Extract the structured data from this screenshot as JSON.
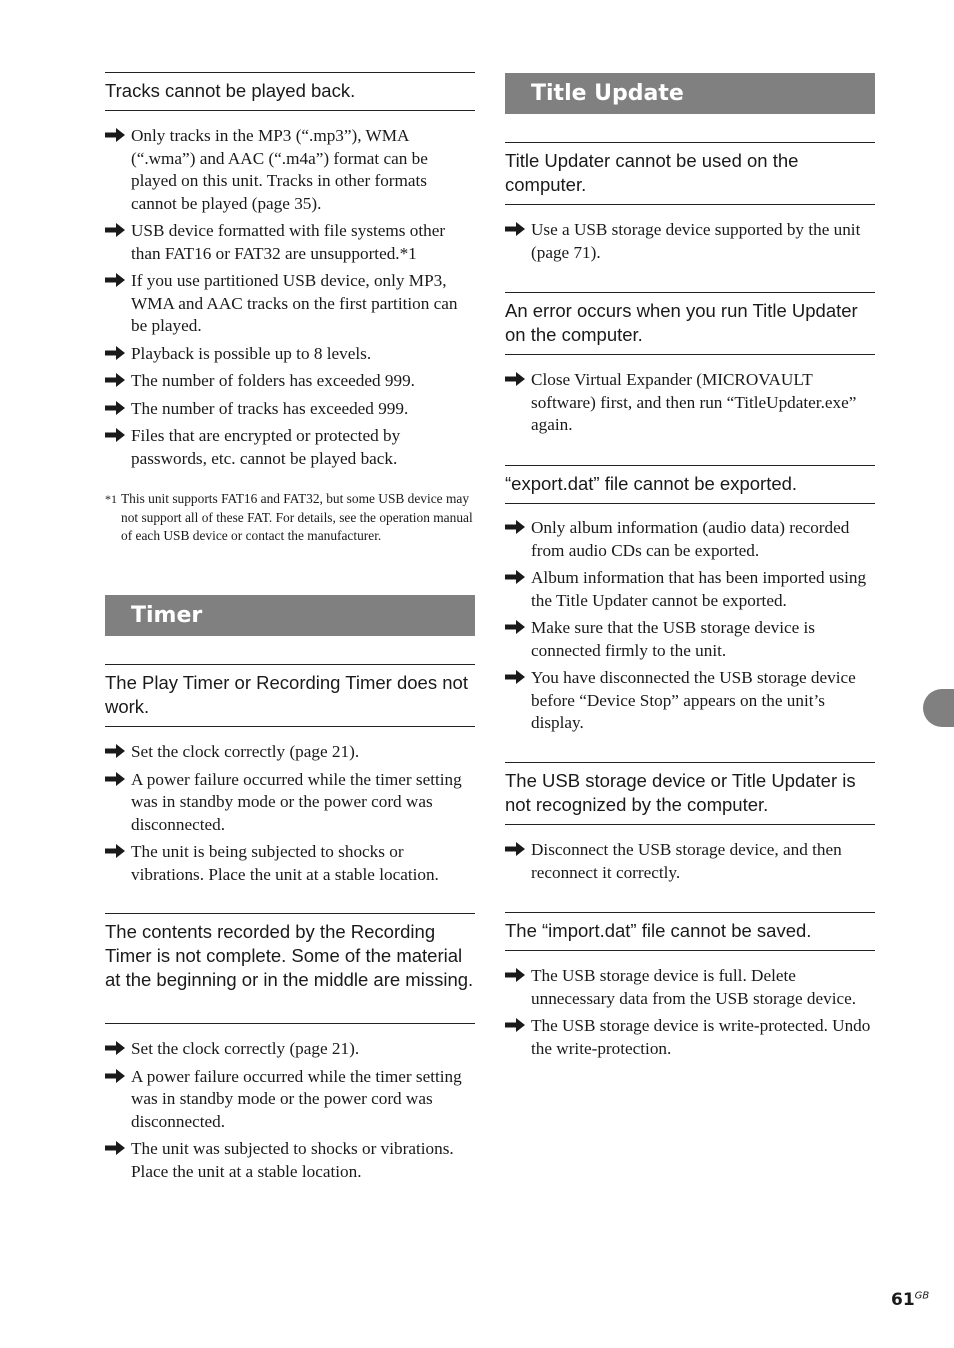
{
  "left": {
    "sec1": {
      "heading": "Tracks cannot be played back.",
      "items": [
        "Only tracks in the MP3 (“.mp3”), WMA (“.wma”) and AAC (“.m4a”) format can be played on this unit. Tracks in other formats cannot be played (page 35).",
        "USB device formatted with file systems other than FAT16 or FAT32 are unsupported.*1",
        "If you use partitioned USB device, only MP3, WMA and AAC tracks on the first partition can be played.",
        "Playback is possible up to 8 levels.",
        "The number of folders has exceeded 999.",
        "The number of tracks has exceeded 999.",
        "Files that are encrypted or protected by passwords, etc. cannot be played back."
      ],
      "footnote_mark": "*1",
      "footnote": "This unit supports FAT16 and FAT32, but some USB device may not support all of these FAT. For details, see the operation manual of each USB device or contact the manufacturer."
    },
    "timer_band": "Timer",
    "sec2": {
      "heading": "The Play Timer or Recording Timer does not work.",
      "items": [
        "Set the clock correctly (page 21).",
        "A power failure occurred while the timer setting was in standby mode or the power cord was disconnected.",
        "The unit is being subjected to shocks or vibrations. Place the unit at a stable location."
      ]
    },
    "sec3": {
      "heading": "The contents recorded by the Recording Timer is not complete. Some of the material at the beginning or in the middle are missing.",
      "items": [
        "Set the clock correctly (page 21).",
        "A power failure occurred while the timer setting was in standby mode or the power cord was disconnected.",
        "The unit was subjected to shocks or vibrations. Place the unit at a stable location."
      ]
    }
  },
  "right": {
    "band": "Title Update",
    "sec1": {
      "heading": "Title Updater cannot be used on the computer.",
      "items": [
        "Use a USB storage device supported by the unit (page 71)."
      ]
    },
    "sec2": {
      "heading": "An error occurs when you run Title Updater on the computer.",
      "items": [
        "Close Virtual Expander (MICROVAULT software) first, and then run “TitleUpdater.exe” again."
      ]
    },
    "sec3": {
      "heading": "“export.dat” file cannot be exported.",
      "items": [
        "Only album information (audio data) recorded from audio CDs can be exported.",
        "Album information that has been imported using the Title Updater cannot be exported.",
        "Make sure that the USB storage device is connected firmly to the unit.",
        "You have disconnected the USB storage device before “Device Stop” appears on the unit’s display."
      ]
    },
    "sec4": {
      "heading": "The USB storage device or Title Updater is not recognized by the computer.",
      "items": [
        "Disconnect the USB storage device, and then reconnect it correctly."
      ]
    },
    "sec5": {
      "heading": "The “import.dat” file cannot be saved.",
      "items": [
        "The USB storage device is full. Delete unnecessary data from the USB storage device.",
        "The USB storage device is write-protected. Undo the write-protection."
      ]
    }
  },
  "page": {
    "number": "61",
    "suffix": "GB"
  },
  "colors": {
    "band": "#808080",
    "text": "#1a1a1a"
  }
}
